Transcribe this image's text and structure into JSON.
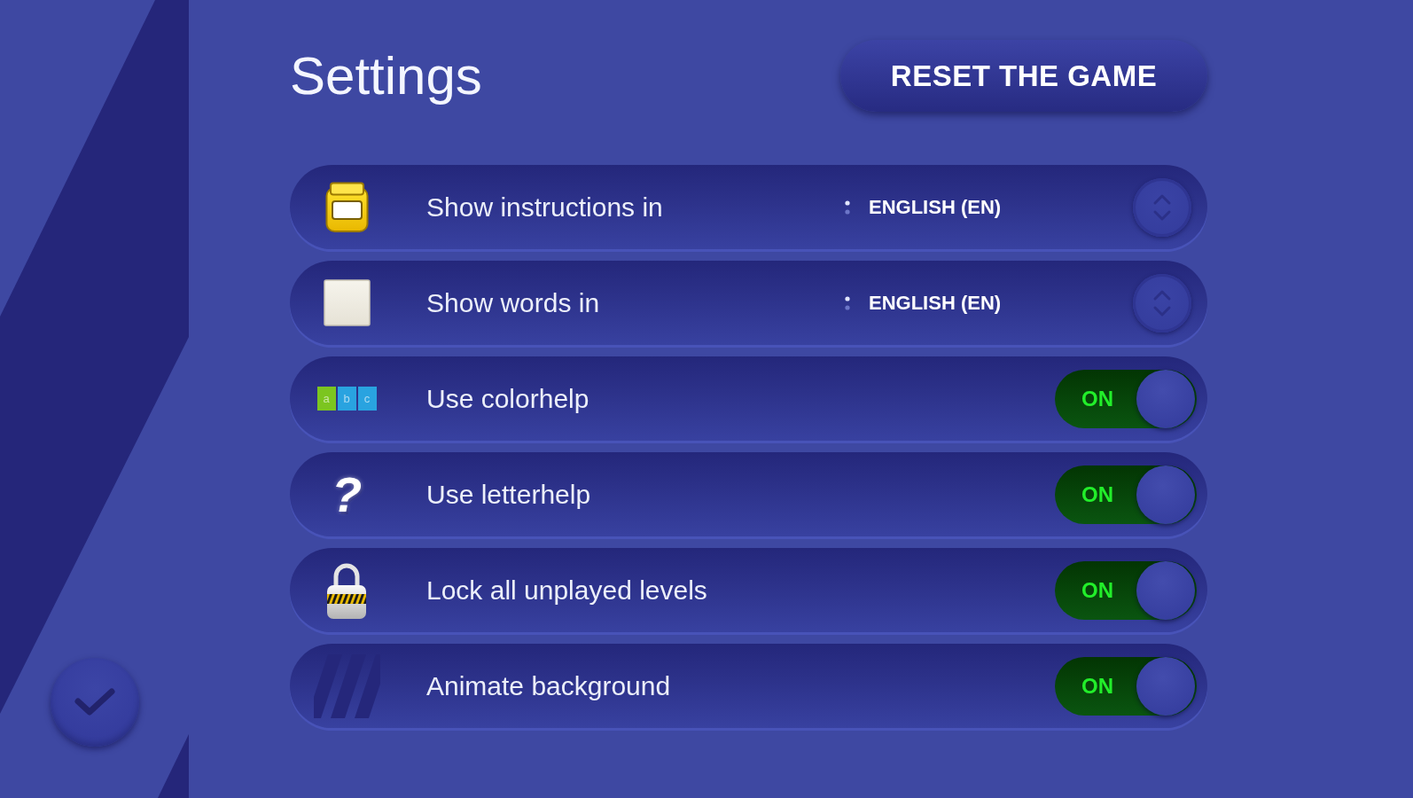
{
  "title": "Settings",
  "reset_button": {
    "label": "RESET THE GAME"
  },
  "settings": [
    {
      "kind": "dropdown",
      "label": "Show instructions in",
      "value": "ENGLISH (EN)"
    },
    {
      "kind": "dropdown",
      "label": "Show words in",
      "value": "ENGLISH (EN)"
    },
    {
      "kind": "toggle",
      "label": "Use colorhelp",
      "on": true,
      "switch_text": "ON",
      "tiles": [
        {
          "letter": "a",
          "color": "#7cc520"
        },
        {
          "letter": "b",
          "color": "#29a3e0"
        },
        {
          "letter": "c",
          "color": "#29a3e0"
        }
      ]
    },
    {
      "kind": "toggle",
      "label": "Use letterhelp",
      "on": true,
      "switch_text": "ON",
      "glyph": "?"
    },
    {
      "kind": "toggle",
      "label": "Lock all unplayed levels",
      "on": true,
      "switch_text": "ON"
    },
    {
      "kind": "toggle",
      "label": "Animate background",
      "on": true,
      "switch_text": "ON"
    }
  ]
}
